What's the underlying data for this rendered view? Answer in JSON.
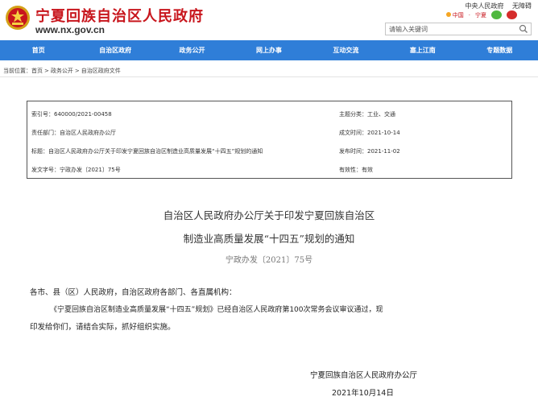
{
  "header": {
    "site_title": "宁夏回族自治区人民政府",
    "site_url": "www.nx.gov.cn",
    "top_links": [
      "中央人民政府",
      "无障碍"
    ],
    "lang": "中国",
    "lang_sep": "·",
    "region": "宁夏",
    "search_placeholder": "请输入关键词"
  },
  "nav": {
    "items": [
      "首页",
      "自治区政府",
      "政务公开",
      "网上办事",
      "互动交流",
      "塞上江南",
      "专题数据"
    ]
  },
  "breadcrumb": {
    "prefix": "当前位置：",
    "items": [
      "首页",
      "政务公开",
      "自治区政府文件"
    ],
    "sep": ">"
  },
  "meta": {
    "rows": [
      {
        "left": "索引号：640000/2021-00458",
        "right": "主题分类：工业、交通"
      },
      {
        "left": "责任部门：自治区人民政府办公厅",
        "right": "成文时间：2021-10-14"
      },
      {
        "left": "标题：自治区人民政府办公厅关于印发宁夏回族自治区制造业高质量发展“十四五”规划的通知",
        "right": "发布时间：2021-11-02"
      },
      {
        "left": "发文字号：宁政办发〔2021〕75号",
        "right": "有效性：有效"
      }
    ]
  },
  "document": {
    "title_line1": "自治区人民政府办公厅关于印发宁夏回族自治区",
    "title_line2": "制造业高质量发展“十四五”规划的通知",
    "doc_number": "宁政办发〔2021〕75号",
    "salutation": "各市、县（区）人民政府，自治区政府各部门、各直属机构：",
    "body_line1": "《宁夏回族自治区制造业高质量发展“十四五”规划》已经自治区人民政府第100次常务会议审议通过，现",
    "body_line2": "印发给你们，请结合实际，抓好组织实施。",
    "signature": "宁夏回族自治区人民政府办公厅",
    "date": "2021年10月14日"
  },
  "colors": {
    "brand_red": "#c8161d",
    "nav_blue": "#2f7ed8"
  }
}
